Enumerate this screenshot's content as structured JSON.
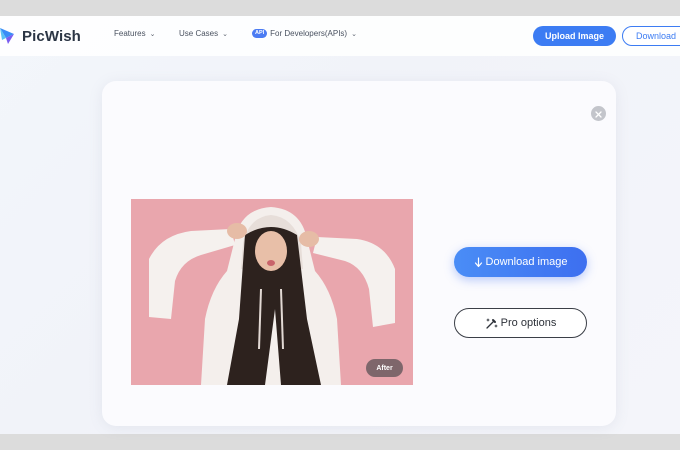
{
  "header": {
    "logo_text": "PicWish",
    "nav": [
      {
        "label": "Features"
      },
      {
        "label": "Use Cases"
      },
      {
        "label": "For Developers(APIs)",
        "badge": "API"
      }
    ],
    "upload_label": "Upload Image",
    "download_label": "Download"
  },
  "result": {
    "badge": "After",
    "download_image_label": "Download image",
    "pro_options_label": "Pro options"
  },
  "colors": {
    "accent": "#3c7cf3",
    "photo_background": "#e8a5ac"
  },
  "icons": {
    "logo": "picwish-logo-icon",
    "nav_chevron": "chevron-down-icon",
    "close": "close-icon",
    "download": "download-arrow-icon",
    "pro": "magic-wand-icon"
  }
}
